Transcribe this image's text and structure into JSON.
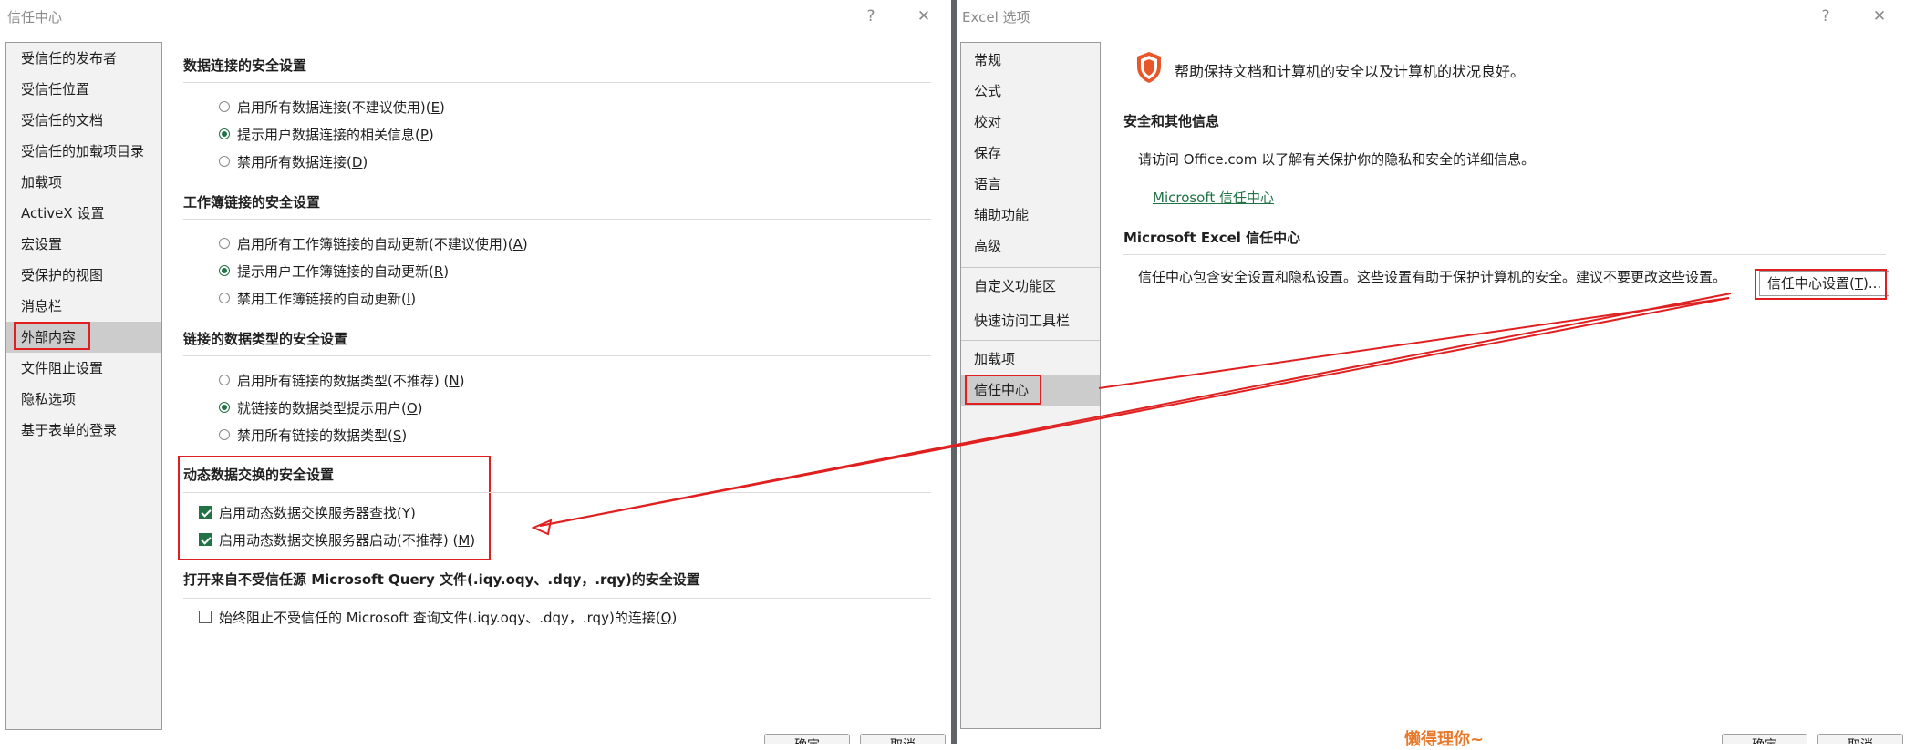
{
  "left_window": {
    "title": "信任中心",
    "help": "?",
    "close": "✕",
    "nav": [
      {
        "label": "受信任的发布者",
        "selected": false
      },
      {
        "label": "受信任位置",
        "selected": false
      },
      {
        "label": "受信任的文档",
        "selected": false
      },
      {
        "label": "受信任的加载项目录",
        "selected": false
      },
      {
        "label": "加载项",
        "selected": false
      },
      {
        "label": "ActiveX 设置",
        "selected": false
      },
      {
        "label": "宏设置",
        "selected": false
      },
      {
        "label": "受保护的视图",
        "selected": false
      },
      {
        "label": "消息栏",
        "selected": false
      },
      {
        "label": "外部内容",
        "selected": true
      },
      {
        "label": "文件阻止设置",
        "selected": false
      },
      {
        "label": "隐私选项",
        "selected": false
      },
      {
        "label": "基于表单的登录",
        "selected": false
      }
    ],
    "sections": [
      {
        "title": "数据连接的安全设置",
        "options": [
          {
            "pre": "启用所有数据连接(不建议使用)(",
            "key": "E",
            "post": ")",
            "checked": false
          },
          {
            "pre": "提示用户数据连接的相关信息(",
            "key": "P",
            "post": ")",
            "checked": true
          },
          {
            "pre": "禁用所有数据连接(",
            "key": "D",
            "post": ")",
            "checked": false
          }
        ]
      },
      {
        "title": "工作簿链接的安全设置",
        "options": [
          {
            "pre": "启用所有工作簿链接的自动更新(不建议使用)(",
            "key": "A",
            "post": ")",
            "checked": false
          },
          {
            "pre": "提示用户工作簿链接的自动更新(",
            "key": "R",
            "post": ")",
            "checked": true
          },
          {
            "pre": "禁用工作簿链接的自动更新(",
            "key": "I",
            "post": ")",
            "checked": false
          }
        ]
      },
      {
        "title": "链接的数据类型的安全设置",
        "options": [
          {
            "pre": "启用所有链接的数据类型(不推荐) (",
            "key": "N",
            "post": ")",
            "checked": false
          },
          {
            "pre": "就链接的数据类型提示用户(",
            "key": "O",
            "post": ")",
            "checked": true
          },
          {
            "pre": "禁用所有链接的数据类型(",
            "key": "S",
            "post": ")",
            "checked": false
          }
        ]
      },
      {
        "title": "动态数据交换的安全设置",
        "checkboxes": [
          {
            "pre": "启用动态数据交换服务器查找(",
            "key": "Y",
            "post": ")",
            "checked": true
          },
          {
            "pre": "启用动态数据交换服务器启动(不推荐) (",
            "key": "M",
            "post": ")",
            "checked": true
          }
        ]
      },
      {
        "title": "打开来自不受信任源 Microsoft Query 文件(.iqy.oqy、.dqy，.rqy)的安全设置",
        "checkboxes": [
          {
            "pre": "始终阻止不受信任的 Microsoft 查询文件(.iqy.oqy、.dqy，.rqy)的连接(",
            "key": "Q",
            "post": ")",
            "checked": false
          }
        ]
      }
    ],
    "bottom_buttons": [
      "确定",
      "取消"
    ]
  },
  "right_window": {
    "title": "Excel 选项",
    "help": "?",
    "close": "✕",
    "nav": [
      {
        "label": "常规",
        "selected": false
      },
      {
        "label": "公式",
        "selected": false
      },
      {
        "label": "校对",
        "selected": false
      },
      {
        "label": "保存",
        "selected": false
      },
      {
        "label": "语言",
        "selected": false
      },
      {
        "label": "辅助功能",
        "selected": false
      },
      {
        "label": "高级",
        "selected": false
      },
      {
        "label": "自定义功能区",
        "selected": false
      },
      {
        "label": "快速访问工具栏",
        "selected": false
      },
      {
        "label": "加载项",
        "selected": false
      },
      {
        "label": "信任中心",
        "selected": true
      }
    ],
    "header_text": "帮助保持文档和计算机的安全以及计算机的状况良好。",
    "header_icon": "shield-icon",
    "security_section": {
      "title": "安全和其他信息",
      "text": "请访问 Office.com 以了解有关保护你的隐私和安全的详细信息。",
      "link": "Microsoft 信任中心"
    },
    "trust_center_section": {
      "title": "Microsoft Excel 信任中心",
      "text": "信任中心包含安全设置和隐私设置。这些设置有助于保护计算机的安全。建议不要更改这些设置。",
      "button_pre": "信任中心设置(",
      "button_key": "T",
      "button_post": ")..."
    },
    "bottom_buttons": [
      "确定",
      "取消"
    ]
  },
  "watermark": "懒得理你~",
  "colors": {
    "accent_green": "#217346",
    "highlight_red": "#e02020",
    "shield_orange": "#e8572a",
    "watermark_orange": "#e8792b"
  }
}
